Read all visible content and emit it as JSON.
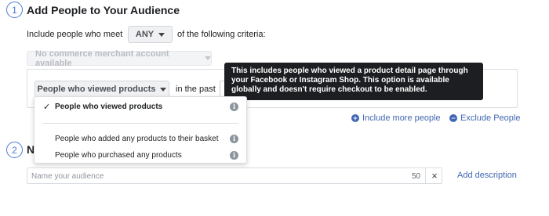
{
  "section1": {
    "step": "1",
    "title": "Add People to Your Audience",
    "include_prefix": "Include people who meet",
    "any_label": "ANY",
    "include_suffix": "of the following criteria:",
    "merchant_select": "No commerce merchant account available",
    "criteria_select": "People who viewed products",
    "in_the_past": "in the past",
    "tooltip": "This includes people who viewed a product detail page through your Facebook or Instagram Shop. This option is available globally and doesn't require checkout to be enabled."
  },
  "dropdown": {
    "items": [
      {
        "label": "People who viewed products",
        "selected": true,
        "info_icon": "i"
      },
      {
        "label": "People who added any products to their basket",
        "selected": false,
        "info_icon": "i"
      },
      {
        "label": "People who purchased any products",
        "selected": false,
        "info_icon": "i"
      }
    ],
    "check_icon": "✓"
  },
  "actions": {
    "include_more": "Include more people",
    "exclude": "Exclude People",
    "include_icon": "+",
    "exclude_icon": "−"
  },
  "section2": {
    "step": "2",
    "title_visible": "N",
    "name_placeholder": "Name your audience",
    "char_count": "50",
    "clear_icon": "×",
    "add_description": "Add description"
  },
  "colors": {
    "accent": "#4267b2",
    "step_circle": "#4b7bd6",
    "tooltip_bg": "#1c1e21"
  }
}
